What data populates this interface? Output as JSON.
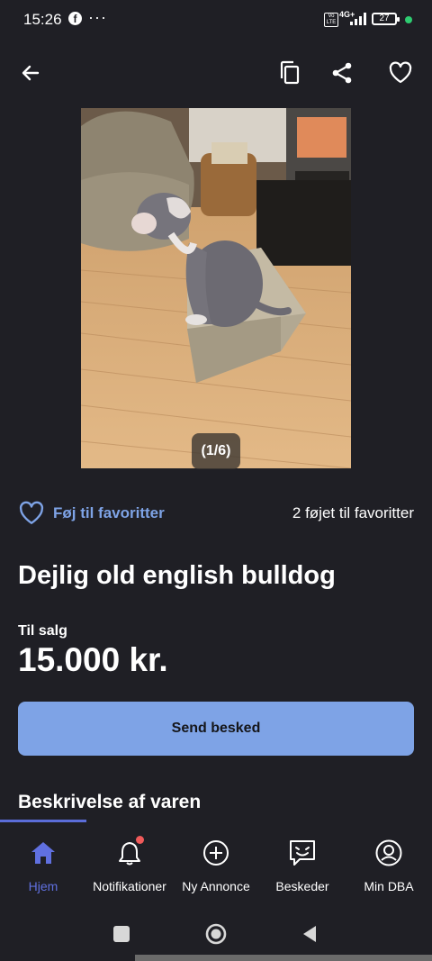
{
  "status_bar": {
    "time": "15:26",
    "fb_glyph": "f",
    "more": "···",
    "volte": "Vo LTE",
    "network": "4G+",
    "battery": "27"
  },
  "toolbar": {
    "back_icon": "arrow-left-icon",
    "copy_icon": "copy-icon",
    "share_icon": "share-icon",
    "favorite_icon": "heart-outline-icon"
  },
  "gallery": {
    "counter": "(1/6)"
  },
  "favorites": {
    "add_label": "Føj til favoritter",
    "count_label": "2 føjet til favoritter"
  },
  "listing": {
    "title": "Dejlig old english bulldog",
    "sale_type": "Til salg",
    "price": "15.000 kr."
  },
  "actions": {
    "send_message": "Send besked"
  },
  "section": {
    "description_title": "Beskrivelse af varen"
  },
  "bottom_nav": {
    "items": [
      {
        "label": "Hjem",
        "icon": "home-icon",
        "active": true
      },
      {
        "label": "Notifikationer",
        "icon": "bell-icon",
        "active": false
      },
      {
        "label": "Ny Annonce",
        "icon": "plus-circle-icon",
        "active": false
      },
      {
        "label": "Beskeder",
        "icon": "chat-icon",
        "active": false
      },
      {
        "label": "Min DBA",
        "icon": "profile-icon",
        "active": false
      }
    ]
  },
  "colors": {
    "background": "#1f1f25",
    "accent_blue": "#7ea3e6",
    "active_nav": "#6070e0",
    "notification_dot": "#f05a5a"
  }
}
